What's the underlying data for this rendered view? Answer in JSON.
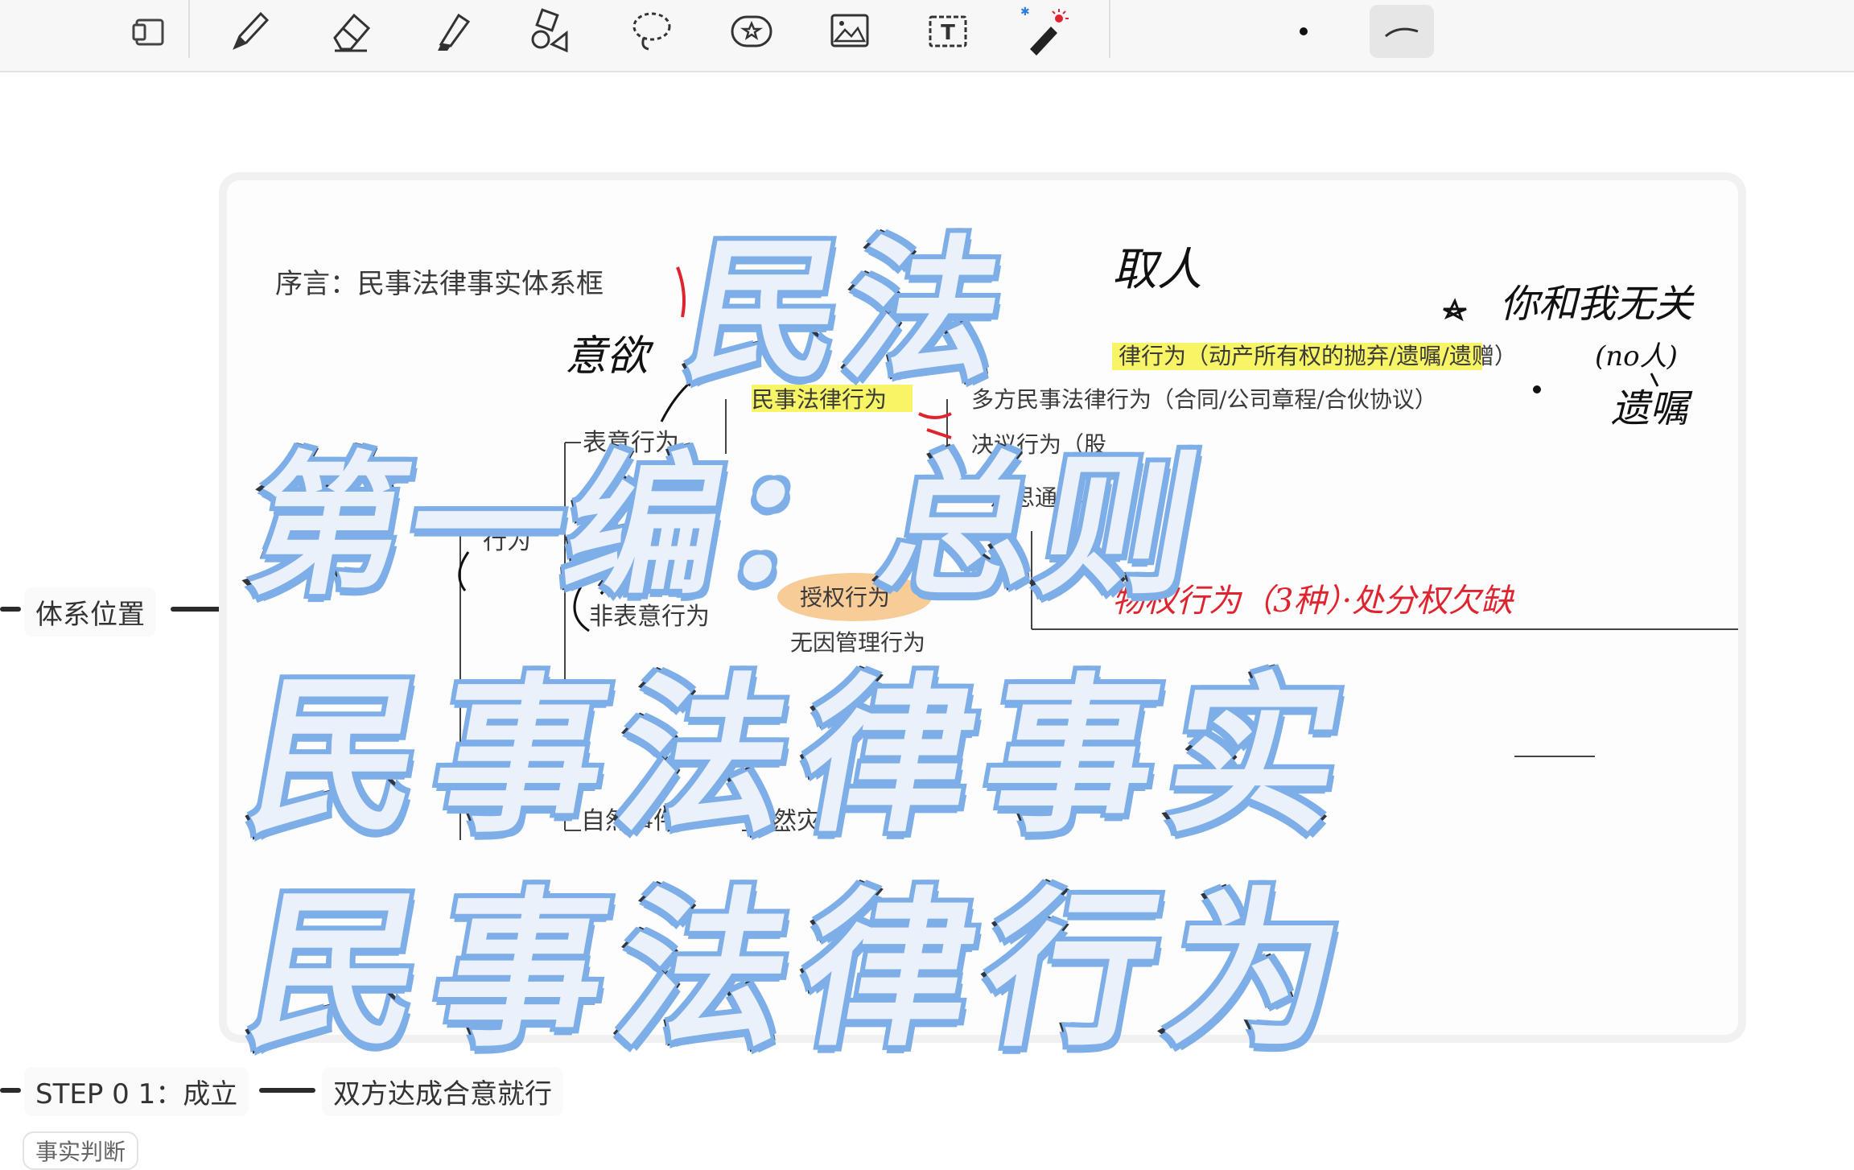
{
  "toolbar": {
    "tools": [
      {
        "name": "page-layout-icon"
      },
      {
        "name": "pen-icon"
      },
      {
        "name": "eraser-icon"
      },
      {
        "name": "highlighter-icon"
      },
      {
        "name": "shapes-icon"
      },
      {
        "name": "lasso-icon"
      },
      {
        "name": "sticker-icon"
      },
      {
        "name": "image-icon"
      },
      {
        "name": "text-box-icon"
      },
      {
        "name": "laser-pointer-icon"
      },
      {
        "name": "dot-size-icon"
      },
      {
        "name": "stroke-style-icon"
      }
    ]
  },
  "mindmap": {
    "node_system_position": "体系位置",
    "node_step1": "STEP 0 1：成立",
    "node_step1_child": "双方达成合意就行",
    "node_fact_tag": "事实判断"
  },
  "note": {
    "preface": "序言：民事法律事实体系框",
    "expression_act": "表意行为",
    "civil_legal_act": "民事法律行为",
    "unilateral_suffix": "律行为（动产所有权的抛弃/遗嘱/遗赠）",
    "multilateral": "多方民事法律行为（合同/公司章程/合伙协议）",
    "resolution": "决议行为（股",
    "notice": "意思通知、",
    "non_expression": "非表意行为",
    "authorization": "授权行为",
    "management": "无因管理行为",
    "natural_event": "自然事件",
    "natural_disaster": "自然灾害",
    "act_short": "行为",
    "hw_will": "意欲",
    "hw_person": "取人",
    "hw_unrelated": "你和我无关",
    "hw_no": "(no人)",
    "hw_testament": "遗嘱",
    "hw_law": "法",
    "hw_red": "物权行为（3种）·处分权欠缺"
  },
  "overlay": {
    "line1": "民法",
    "line2": "第一编：总则",
    "line3": "民事法律事实",
    "line4": "民事法律行为"
  },
  "colors": {
    "highlight_yellow": "#f6f24a",
    "highlight_orange": "#f7c68c",
    "red_ink": "#e0242f",
    "title_fill": "#eaf1fb",
    "title_outline": "#2f3640",
    "title_glow": "#7eaee8"
  }
}
